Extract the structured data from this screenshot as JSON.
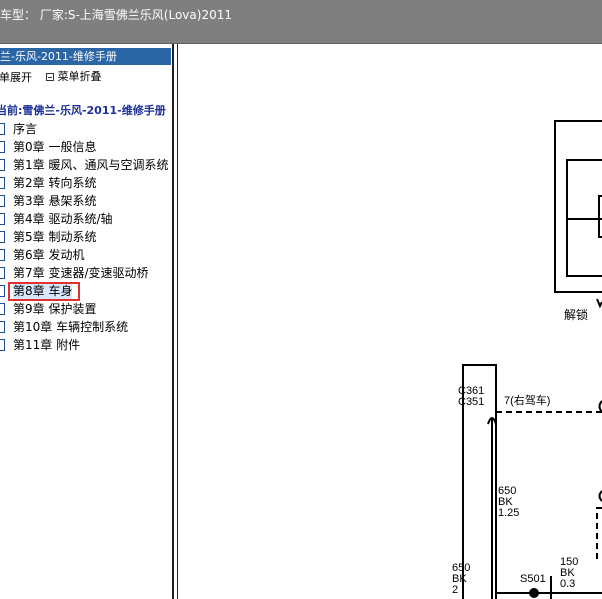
{
  "window": {
    "title": "车型： 厂家:S-上海雪佛兰乐风(Lova)2011"
  },
  "sidebar": {
    "header": "兰-乐风-2011-维修手册",
    "expand_label": "菜单展开",
    "collapse_label": "菜单折叠",
    "current_label": "当前:雪佛兰-乐风-2011-维修手册",
    "items": [
      {
        "label": "序言"
      },
      {
        "label": "第0章 一般信息"
      },
      {
        "label": "第1章 暖风、通风与空调系统"
      },
      {
        "label": "第2章 转向系统"
      },
      {
        "label": "第3章 悬架系统"
      },
      {
        "label": "第4章 驱动系统/轴"
      },
      {
        "label": "第5章 制动系统"
      },
      {
        "label": "第6章 发动机"
      },
      {
        "label": "第7章 变速器/变速驱动桥"
      },
      {
        "label": "第8章 车身"
      },
      {
        "label": "第9章 保护装置"
      },
      {
        "label": "第10章 车辆控制系统"
      },
      {
        "label": "第11章 附件"
      }
    ],
    "selected_index": 9
  },
  "diagram": {
    "unlock_label": "解锁",
    "connector_top": "C361",
    "connector_bottom": "C351",
    "pin_label": "7(右驾车)",
    "wire_650_125": {
      "circuit": "650",
      "color": "BK",
      "gauge": "1.25"
    },
    "wire_650_2": {
      "circuit": "650",
      "color": "BK",
      "gauge": "2"
    },
    "wire_150": {
      "circuit": "150",
      "color": "BK",
      "gauge": "0.3"
    },
    "splice": "S501"
  }
}
